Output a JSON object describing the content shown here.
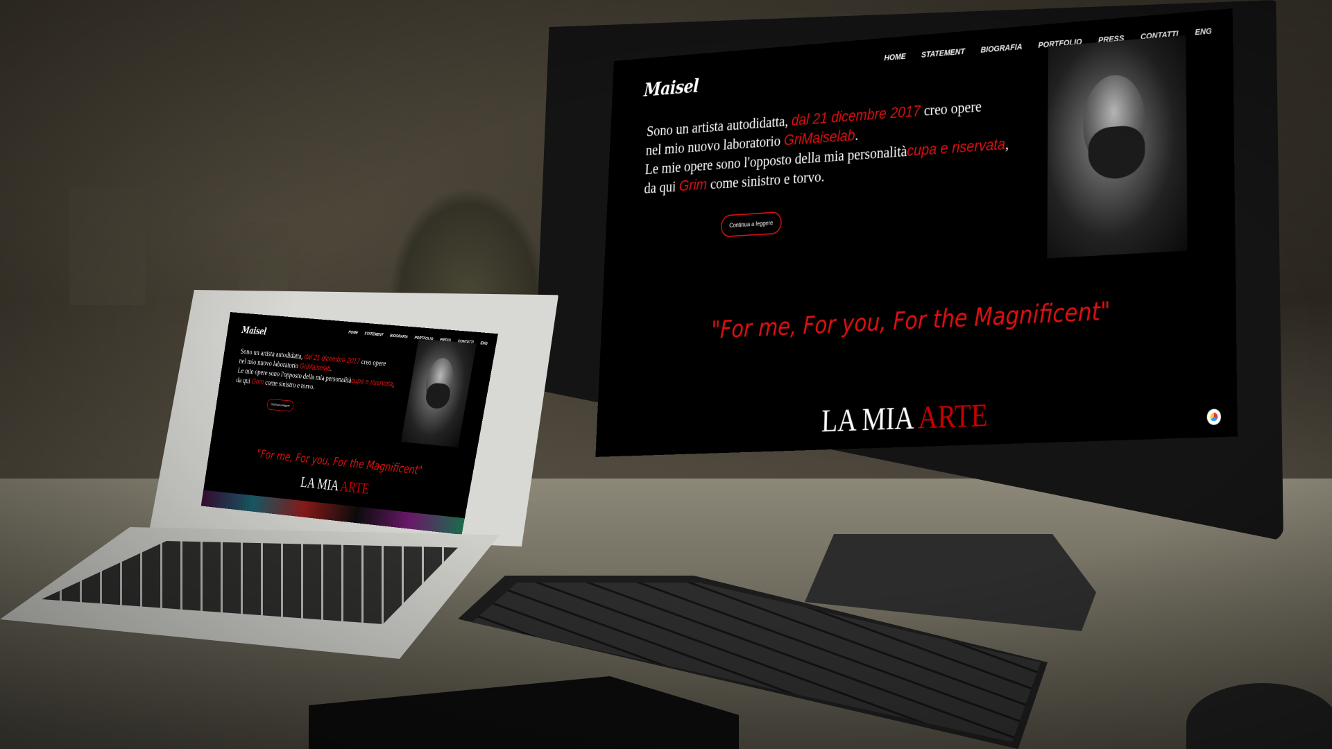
{
  "site": {
    "logo": "Maisel",
    "nav": [
      "HOME",
      "STATEMENT",
      "BIOGRAFIA",
      "PORTFOLIO",
      "PRESS",
      "CONTATTI",
      "ENG"
    ],
    "intro": {
      "l1a": "Sono un artista autodidatta, ",
      "l1b": "dal 21 dicembre 2017",
      "l1c": " creo opere",
      "l2a": "nel mio nuovo laboratorio ",
      "l2b": "GriMaiselab",
      "l2c": ".",
      "l3a": "Le mie opere sono l'opposto della mia personalità",
      "l3b": "cupa e riservata",
      "l3c": ",",
      "l4a": "da qui ",
      "l4b": "Grim",
      "l4c": " come sinistro e torvo."
    },
    "button": "Continua a leggere",
    "quote": "\"For me, For you, For the Magnificent\"",
    "section_title_a": "LA MIA ",
    "section_title_b": "ARTE"
  },
  "colors": {
    "accent": "#e11010",
    "background": "#000000",
    "text": "#ffffff"
  },
  "icons": [
    "portrait-photo",
    "chat-widget-icon"
  ]
}
